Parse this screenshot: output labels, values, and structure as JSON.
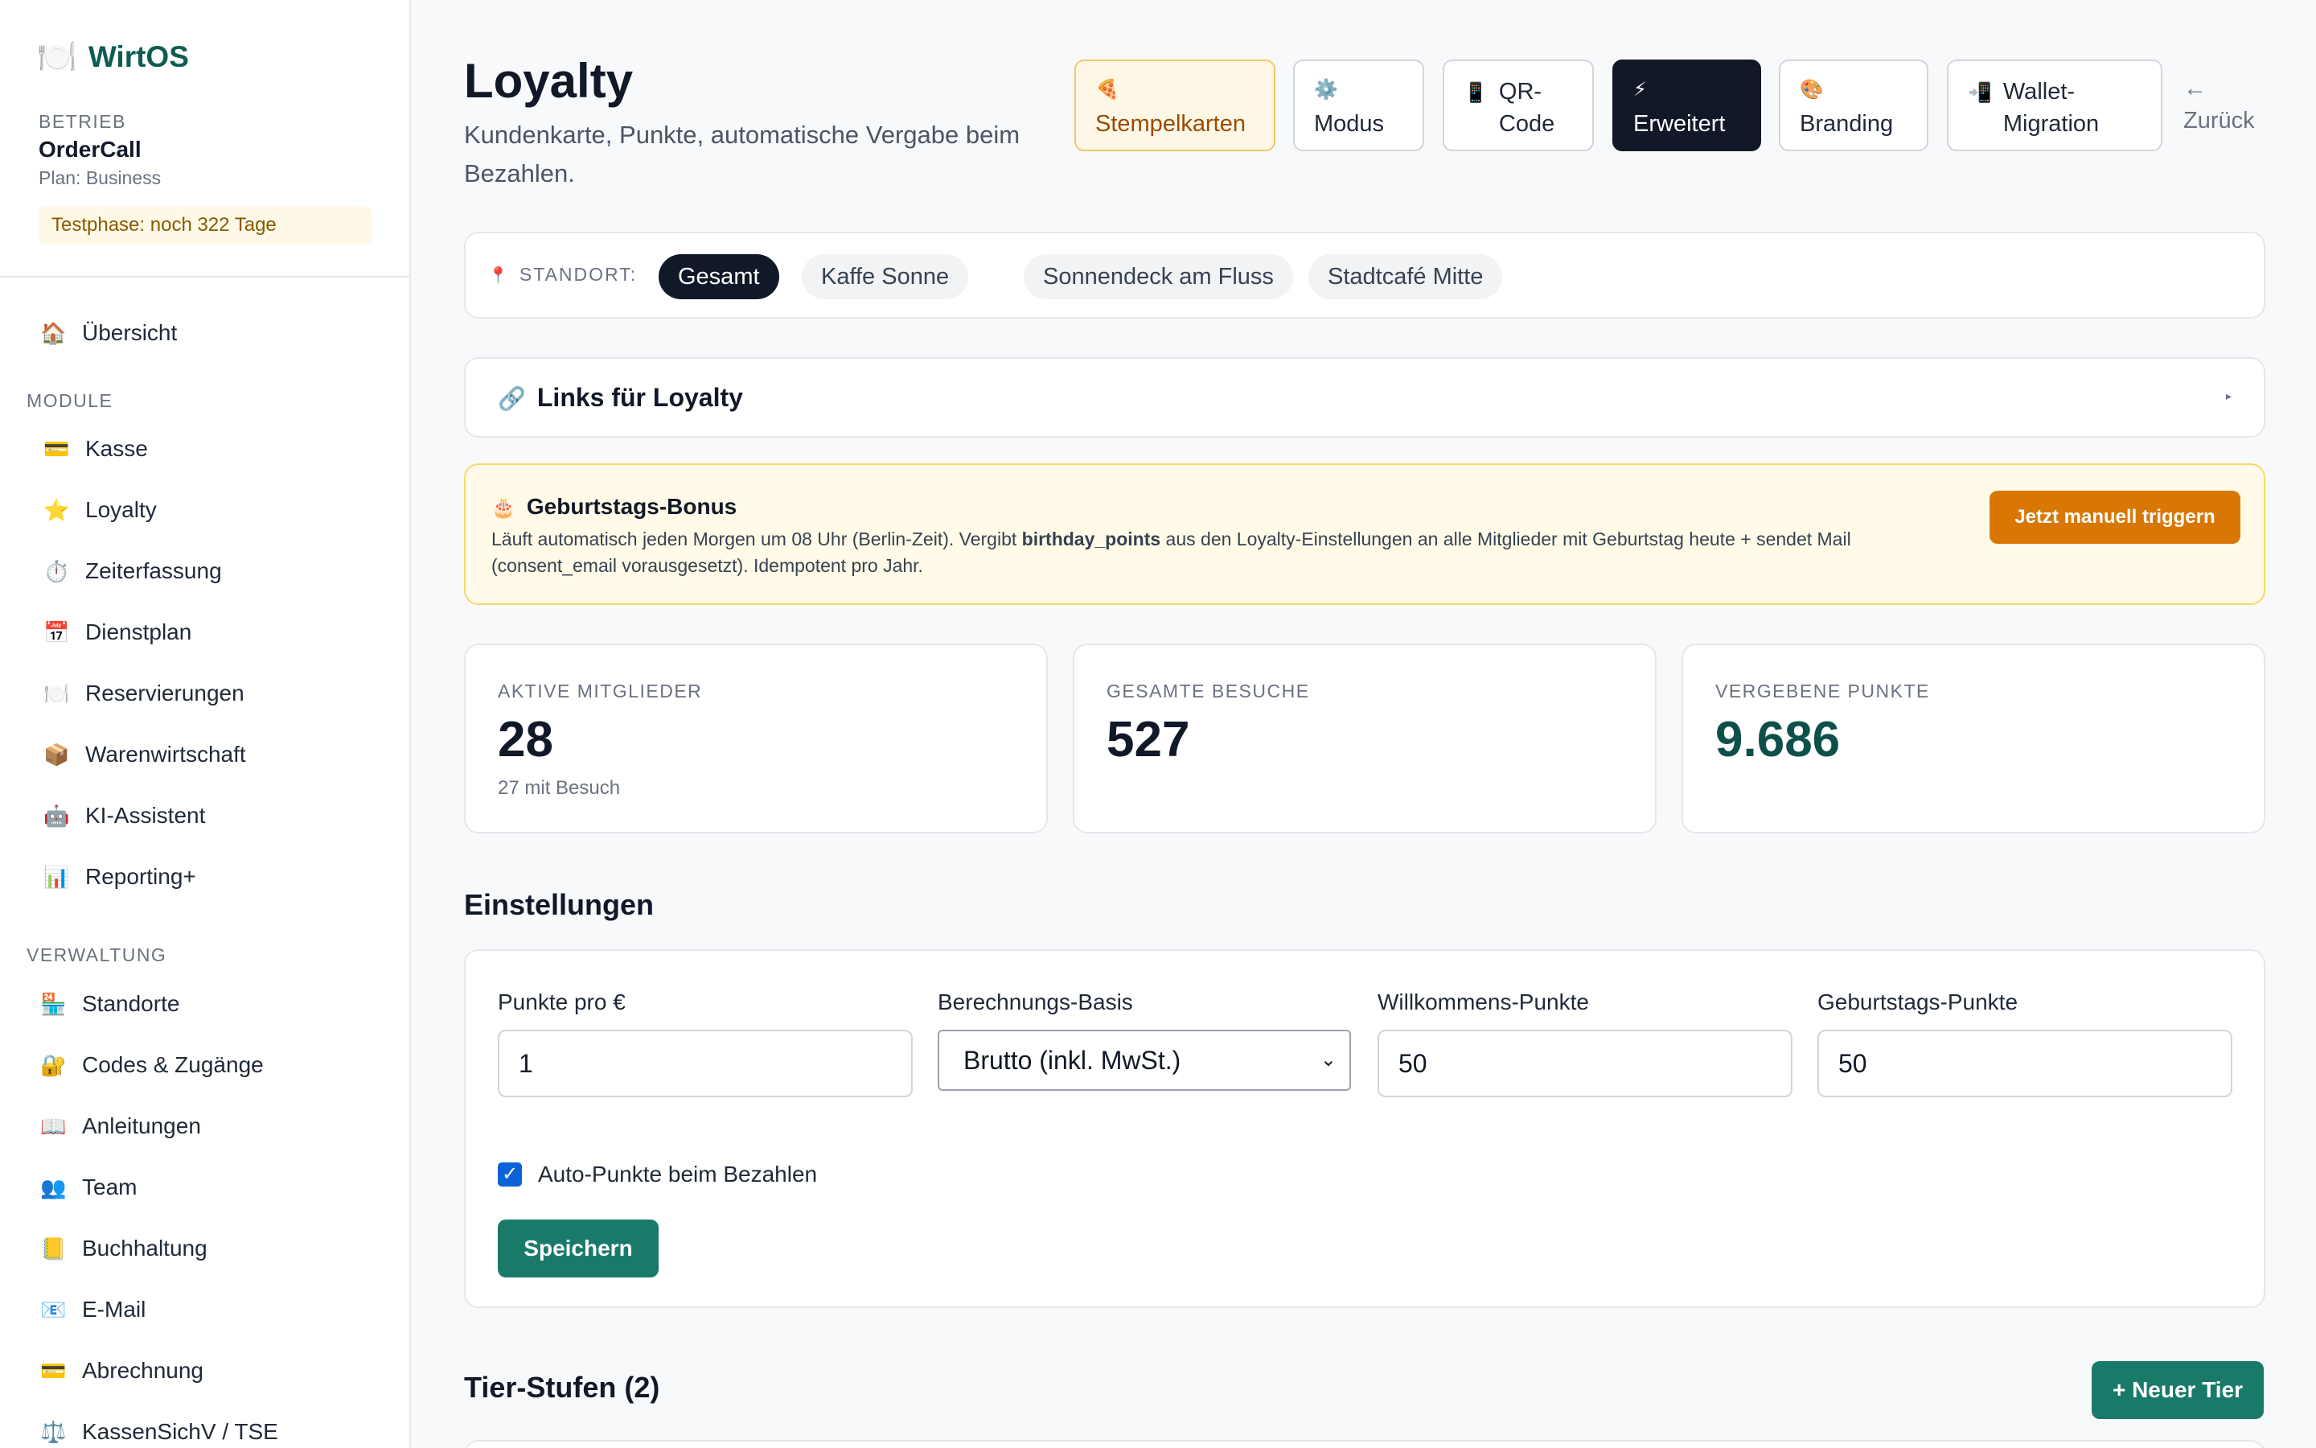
{
  "app": {
    "icon": "🍽️",
    "name": "WirtOS"
  },
  "business": {
    "label": "BETRIEB",
    "name": "OrderCall",
    "plan": "Plan: Business",
    "trial": "Testphase: noch 322 Tage"
  },
  "sidebar": {
    "overview": {
      "icon": "🏠",
      "label": "Übersicht"
    },
    "modules_label": "MODULE",
    "modules": [
      {
        "icon": "💳",
        "label": "Kasse"
      },
      {
        "icon": "⭐",
        "label": "Loyalty"
      },
      {
        "icon": "⏱️",
        "label": "Zeiterfassung"
      },
      {
        "icon": "📅",
        "label": "Dienstplan"
      },
      {
        "icon": "🍽️",
        "label": "Reservierungen"
      },
      {
        "icon": "📦",
        "label": "Warenwirtschaft"
      },
      {
        "icon": "🤖",
        "label": "KI-Assistent"
      },
      {
        "icon": "📊",
        "label": "Reporting+"
      }
    ],
    "admin_label": "VERWALTUNG",
    "admin": [
      {
        "icon": "🏪",
        "label": "Standorte"
      },
      {
        "icon": "🔐",
        "label": "Codes & Zugänge"
      },
      {
        "icon": "📖",
        "label": "Anleitungen"
      },
      {
        "icon": "👥",
        "label": "Team"
      },
      {
        "icon": "📒",
        "label": "Buchhaltung"
      },
      {
        "icon": "📧",
        "label": "E-Mail"
      },
      {
        "icon": "💳",
        "label": "Abrechnung"
      },
      {
        "icon": "⚖️",
        "label": "KassenSichV / TSE"
      }
    ]
  },
  "header": {
    "title": "Loyalty",
    "subtitle": "Kundenkarte, Punkte, automatische Vergabe beim Bezahlen.",
    "tabs": [
      {
        "icon": "🍕",
        "label": "Stempelkarten"
      },
      {
        "icon": "⚙️",
        "label": "Modus"
      },
      {
        "icon": "📱",
        "label": "QR-Code"
      },
      {
        "icon": "⚡",
        "label": "Erweitert"
      },
      {
        "icon": "🎨",
        "label": "Branding"
      },
      {
        "icon": "📲",
        "label": "Wallet-Migration"
      }
    ],
    "back": {
      "icon": "←",
      "label": "Zurück"
    }
  },
  "location_filter": {
    "icon": "📍",
    "label": "STANDORT:",
    "chips": [
      "Gesamt",
      "Kaffe Sonne",
      "Sonnendeck am Fluss",
      "Stadtcafé Mitte"
    ]
  },
  "links": {
    "icon": "🔗",
    "title": "Links für Loyalty",
    "caret": "▸"
  },
  "birthday": {
    "icon": "🎂",
    "title": "Geburtstags-Bonus",
    "text_before": "Läuft automatisch jeden Morgen um 08 Uhr (Berlin-Zeit). Vergibt ",
    "text_bold": "birthday_points",
    "text_after": " aus den Loyalty-Einstellungen an alle Mitglieder mit Geburtstag heute + sendet Mail (consent_email vorausgesetzt). Idempotent pro Jahr.",
    "button": "Jetzt manuell triggern"
  },
  "stats": [
    {
      "label": "AKTIVE MITGLIEDER",
      "value": "28",
      "sub": "27 mit Besuch"
    },
    {
      "label": "GESAMTE BESUCHE",
      "value": "527",
      "sub": ""
    },
    {
      "label": "VERGEBENE PUNKTE",
      "value": "9.686",
      "sub": ""
    }
  ],
  "settings": {
    "title": "Einstellungen",
    "fields": [
      {
        "label": "Punkte pro €",
        "value": "1"
      },
      {
        "label": "Berechnungs-Basis",
        "value": "Brutto (inkl. MwSt.)"
      },
      {
        "label": "Willkommens-Punkte",
        "value": "50"
      },
      {
        "label": "Geburtstags-Punkte",
        "value": "50"
      }
    ],
    "auto_points_label": "Auto-Punkte beim Bezahlen",
    "auto_points_checked": true,
    "save": "Speichern"
  },
  "tiers": {
    "title": "Tier-Stufen (2)",
    "new_button": "+ Neuer Tier"
  }
}
